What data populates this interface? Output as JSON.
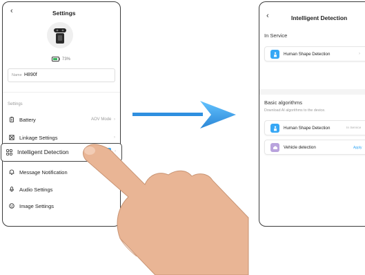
{
  "colors": {
    "accent": "#36a7f5",
    "hand": "#e9b595",
    "arrow": "#3aa0ee",
    "vehicle_icon": "#b9a3dd",
    "battery_green": "#35b057"
  },
  "settings_screen": {
    "back_icon": "chevron-left-icon",
    "title": "Settings",
    "battery_percent": "73%",
    "name_label": "Name",
    "name_value": "H890f",
    "section_label": "Settings",
    "items": [
      {
        "label": "Battery",
        "icon": "battery-icon",
        "value": "AOV Mode"
      },
      {
        "label": "Linkage Settings",
        "icon": "linkage-icon",
        "value": ""
      },
      {
        "label": "Intelligent Detection",
        "icon": "grid-icon",
        "value": ""
      },
      {
        "label": "Message Notification",
        "icon": "bell-icon",
        "value": ""
      },
      {
        "label": "Audio Settings",
        "icon": "microphone-icon",
        "value": ""
      },
      {
        "label": "Image Settings",
        "icon": "image-settings-icon",
        "value": ""
      }
    ]
  },
  "detection_screen": {
    "back_icon": "chevron-left-icon",
    "title": "Intelligent Detection",
    "in_service_label": "In Service",
    "in_service_item": {
      "label": "Human Shape Detection"
    },
    "basic_title": "Basic algorithms",
    "basic_subtitle": "Download AI algorithms to the device.",
    "algorithms": [
      {
        "label": "Human Shape Detection",
        "status": "In Service",
        "icon": "human-shape-icon"
      },
      {
        "label": "Vehicle detection",
        "status": "Apply",
        "icon": "vehicle-icon"
      }
    ]
  }
}
